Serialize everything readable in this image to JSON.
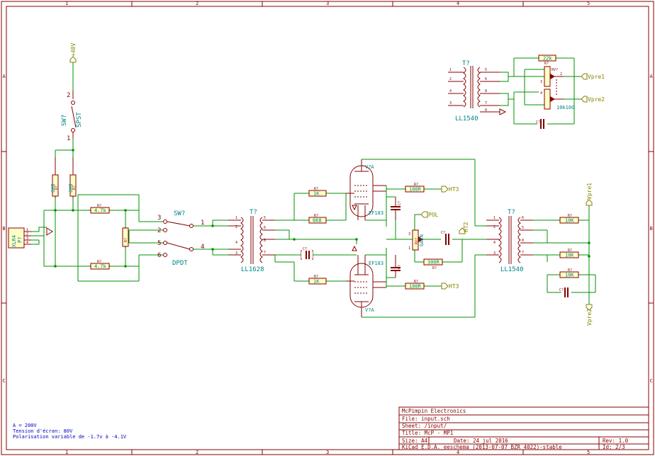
{
  "frame": {
    "columns": [
      "1",
      "2",
      "3",
      "4",
      "5"
    ],
    "rows": [
      "A",
      "B",
      "C"
    ]
  },
  "components": {
    "sw_spst_ref": "SW?",
    "sw_spst_val": "SPST",
    "sw_dpdt_ref": "SW?",
    "sw_dpdt_val": "DPDT",
    "t_in_ref": "T?",
    "t_in_val": "LL1628",
    "t_out_ref": "T?",
    "t_out_val": "LL1540",
    "t_top_ref": "T?",
    "t_top_val": "LL1540",
    "v1_ref": "V?A",
    "v1_val": "EF183",
    "v2_ref": "V?A",
    "v2_val": "EF183",
    "conn_ref": "P?",
    "conn_val": "XLR4",
    "pot_ref": "RV?",
    "pot_val": "GAIN",
    "pot2_val": "10k10G",
    "pot2_ref": "RV?",
    "r_47k_a": "4.7k",
    "r_47k_b": "4.7k",
    "r_1k": "1K",
    "r_6k8": "6K8",
    "r_100r_a": "100R",
    "r_100r_b": "100R",
    "r_300r": "300R",
    "r_10k_a": "10K",
    "r_10k_b": "10K",
    "r_10k_c": "10K",
    "r_22k": "22k",
    "r_ref": "R?",
    "c_ref": "C?"
  },
  "ports": {
    "p48v": "+48V",
    "ht3_a": "HT3",
    "ht3_b": "HT3",
    "pol": "POL",
    "ht2": "HT2",
    "vpre1_a": "Vpre1",
    "vpre2_a": "Vpre2",
    "vpre1_b": "Vpre1",
    "vpre2_b": "Vpre2"
  },
  "notes": {
    "line1": "A = 200V",
    "line2": "Tension d'écran: 80V",
    "line3": "Polarisation variable de -1.7v à -4.1V"
  },
  "title_block": {
    "company": "McPimpin Electronics",
    "file": "File: input.sch",
    "sheet": "Sheet: /input/",
    "title": "Title: McP - MP1",
    "size": "Size: A4",
    "date": "Date: 24 jul 2016",
    "rev": "Rev: 1.0",
    "kicad": "KiCad E.D.A.  eeschema (2013-07-07 BZR 4022)-stable",
    "id": "Id: 2/3"
  },
  "colors": {
    "frame": "#840000",
    "wire": "#009000",
    "text_ref": "#008484",
    "port": "#848400",
    "note": "#0000c0"
  }
}
